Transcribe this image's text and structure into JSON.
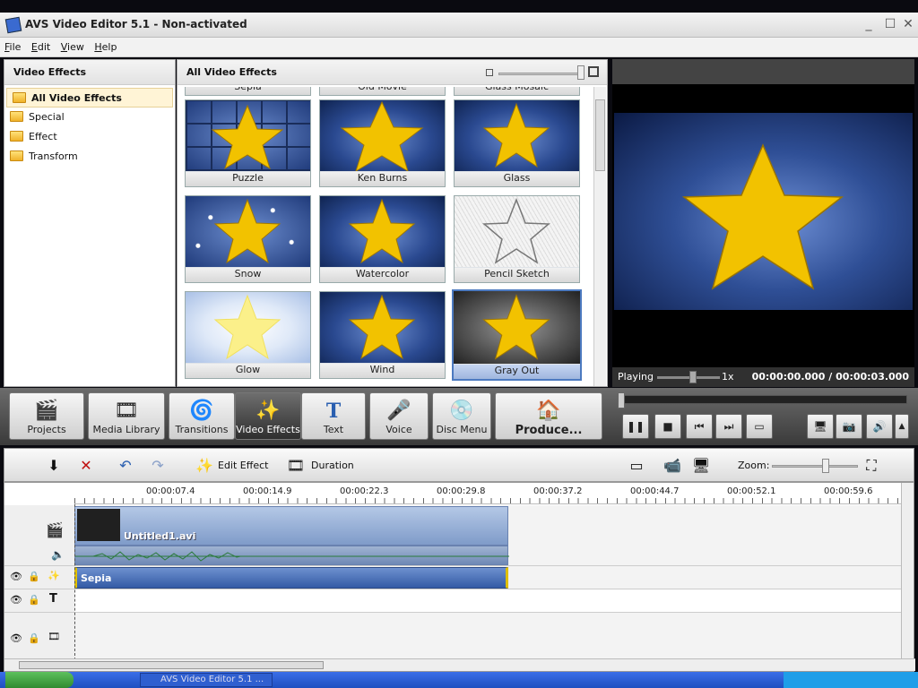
{
  "window": {
    "title": "AVS Video Editor 5.1 - Non-activated"
  },
  "menu": [
    "File",
    "Edit",
    "View",
    "Help"
  ],
  "left_panel": {
    "title": "Video Effects",
    "categories": [
      "All Video Effects",
      "Special",
      "Effect",
      "Transform"
    ],
    "selected": "All Video Effects"
  },
  "effects_panel": {
    "title": "All Video Effects",
    "tiles": [
      "Puzzle",
      "Ken Burns",
      "Glass",
      "Snow",
      "Watercolor",
      "Pencil Sketch",
      "Glow",
      "Wind",
      "Gray Out"
    ],
    "partial_top": [
      "Sepia",
      "Old Movie",
      "Glass Mosaic"
    ],
    "selected": "Gray Out"
  },
  "preview": {
    "status": "Playing",
    "speed": "1x",
    "time": "00:00:00.000 / 00:00:03.000"
  },
  "toolbar": {
    "projects": "Projects",
    "media_library": "Media Library",
    "transitions": "Transitions",
    "video_effects": "Video Effects",
    "text": "Text",
    "voice": "Voice",
    "disc_menu": "Disc Menu",
    "produce": "Produce..."
  },
  "timeline_tools": {
    "edit_effect": "Edit Effect",
    "duration": "Duration",
    "zoom": "Zoom:"
  },
  "timeline": {
    "ticks": [
      "00:00:07.4",
      "00:00:14.9",
      "00:00:22.3",
      "00:00:29.8",
      "00:00:37.2",
      "00:00:44.7",
      "00:00:52.1",
      "00:00:59.6"
    ],
    "clip_name": "Untitled1.avi",
    "effect_clip": "Sepia"
  },
  "taskbar": {
    "task": "AVS Video Editor 5.1 ..."
  },
  "colors": {
    "accent": "#4c7ac0",
    "star": "#f2c200",
    "effect_clip": "#345ba5"
  }
}
